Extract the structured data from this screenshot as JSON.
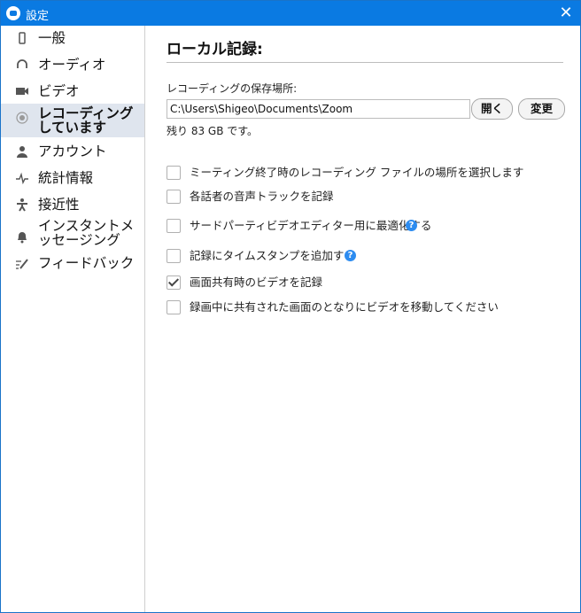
{
  "window": {
    "title": "設定",
    "close_glyph": "✕"
  },
  "sidebar": {
    "items": [
      {
        "label": "一般",
        "icon": "phone-icon"
      },
      {
        "label": "オーディオ",
        "icon": "headphones-icon"
      },
      {
        "label": "ビデオ",
        "icon": "video-camera-icon"
      },
      {
        "label": "レコーディングしています",
        "icon": "record-icon",
        "active": true
      },
      {
        "label": "アカウント",
        "icon": "person-icon"
      },
      {
        "label": "統計情報",
        "icon": "pulse-icon"
      },
      {
        "label": "接近性",
        "icon": "accessibility-icon"
      },
      {
        "label": "インスタントメッセージング",
        "icon": "bell-icon"
      },
      {
        "label": "フィードバック",
        "icon": "feedback-pencil-icon"
      }
    ]
  },
  "main": {
    "heading": "ローカル記録:",
    "location_label": "レコーディングの保存場所:",
    "location_value": "C:\\Users\\Shigeo\\Documents\\Zoom",
    "open_button": "開く",
    "change_button": "変更",
    "remaining": "残り 83 GB です。",
    "options": [
      {
        "label": "ミーティング終了時のレコーディング ファイルの場所を選択します",
        "checked": false
      },
      {
        "label": "各話者の音声トラックを記録",
        "checked": false
      },
      {
        "label": "サードパーティビデオエディター用に最適化する",
        "checked": false,
        "help": true
      },
      {
        "label": "記録にタイムスタンプを追加する",
        "checked": false,
        "help": true
      },
      {
        "label": "画面共有時のビデオを記録",
        "checked": true
      },
      {
        "label": "録画中に共有された画面のとなりにビデオを移動してください",
        "checked": false
      }
    ],
    "help_glyph": "?"
  },
  "colors": {
    "titlebar": "#0a7ae2",
    "active_nav": "#dfe5ee",
    "help_icon": "#2d8cf0"
  }
}
